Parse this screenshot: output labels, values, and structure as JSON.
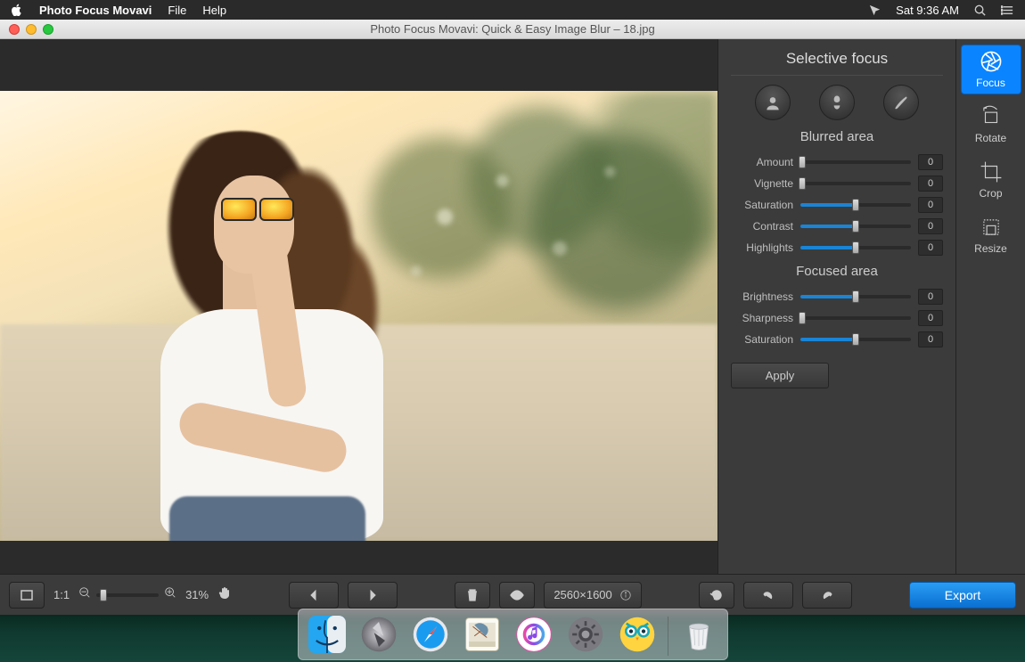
{
  "menubar": {
    "app_name": "Photo Focus Movavi",
    "items": [
      "File",
      "Help"
    ],
    "clock": "Sat 9:36 AM"
  },
  "window": {
    "title": "Photo Focus Movavi: Quick & Easy Image Blur – 18.jpg"
  },
  "panel": {
    "title": "Selective focus",
    "section_blurred": "Blurred area",
    "section_focused": "Focused area",
    "sliders_blurred": [
      {
        "label": "Amount",
        "value": "0",
        "fill": "none",
        "thumb": 2
      },
      {
        "label": "Vignette",
        "value": "0",
        "fill": "none",
        "thumb": 2
      },
      {
        "label": "Saturation",
        "value": "0",
        "fill": "half",
        "thumb": 50
      },
      {
        "label": "Contrast",
        "value": "0",
        "fill": "half",
        "thumb": 50
      },
      {
        "label": "Highlights",
        "value": "0",
        "fill": "half",
        "thumb": 50
      }
    ],
    "sliders_focused": [
      {
        "label": "Brightness",
        "value": "0",
        "fill": "half",
        "thumb": 50
      },
      {
        "label": "Sharpness",
        "value": "0",
        "fill": "none",
        "thumb": 2
      },
      {
        "label": "Saturation",
        "value": "0",
        "fill": "half",
        "thumb": 50
      }
    ],
    "apply": "Apply"
  },
  "tabs": {
    "focus": "Focus",
    "rotate": "Rotate",
    "crop": "Crop",
    "resize": "Resize"
  },
  "bottom": {
    "fit_label": "1:1",
    "zoom": "31%",
    "dimensions": "2560×1600",
    "export": "Export"
  },
  "dock": {
    "items": [
      "finder",
      "launchpad",
      "safari",
      "mail",
      "music",
      "settings",
      "owl",
      "trash"
    ]
  }
}
